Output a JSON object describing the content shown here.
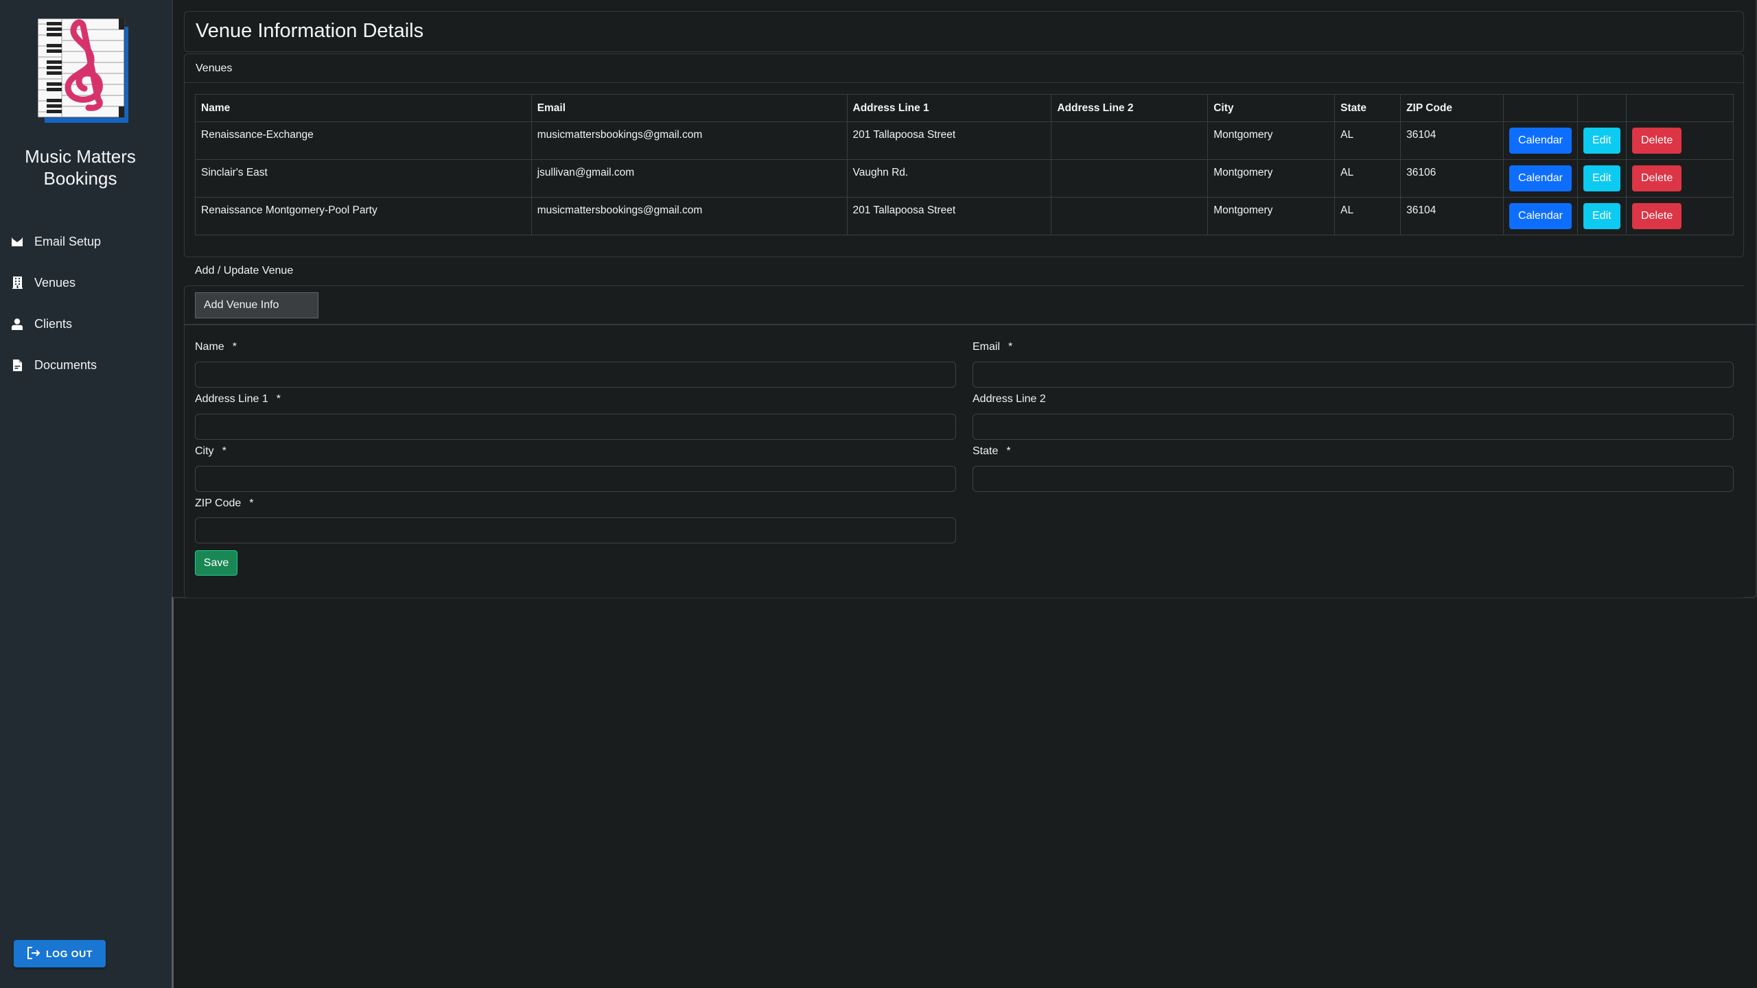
{
  "sidebar": {
    "brand": "Music Matters Bookings",
    "brand_line1": "Music Matters",
    "brand_line2": "Bookings",
    "logo": "treble-clef-piano-logo",
    "items": [
      {
        "label": "Email Setup",
        "icon": "envelope-icon"
      },
      {
        "label": "Venues",
        "icon": "building-icon"
      },
      {
        "label": "Clients",
        "icon": "person-icon"
      },
      {
        "label": "Documents",
        "icon": "document-icon"
      }
    ],
    "logout_label": "LOG OUT",
    "logout_icon": "logout-icon"
  },
  "page": {
    "title": "Venue Information Details"
  },
  "venues": {
    "header": "Venues",
    "columns": [
      "Name",
      "Email",
      "Address Line 1",
      "Address Line 2",
      "City",
      "State",
      "ZIP Code",
      "",
      "",
      ""
    ],
    "rows": [
      {
        "name": "Renaissance-Exchange",
        "email": "musicmattersbookings@gmail.com",
        "address1": "201 Tallapoosa Street",
        "address2": "",
        "city": "Montgomery",
        "state": "AL",
        "zip": "36104"
      },
      {
        "name": "Sinclair's East",
        "email": "jsullivan@gmail.com",
        "address1": "Vaughn Rd.",
        "address2": "",
        "city": "Montgomery",
        "state": "AL",
        "zip": "36106"
      },
      {
        "name": "Renaissance Montgomery-Pool Party",
        "email": "musicmattersbookings@gmail.com",
        "address1": "201 Tallapoosa Street",
        "address2": "",
        "city": "Montgomery",
        "state": "AL",
        "zip": "36104"
      }
    ],
    "actions": {
      "calendar": "Calendar",
      "edit": "Edit",
      "delete": "Delete"
    },
    "colors": {
      "calendar": "#0d6efd",
      "edit": "#0dcaf0",
      "delete": "#dc3545"
    }
  },
  "form": {
    "section_label": "Add / Update Venue",
    "tab_label": "Add Venue Info",
    "required_marker": "*",
    "fields": {
      "name": {
        "label": "Name",
        "value": "",
        "placeholder": ""
      },
      "email": {
        "label": "Email",
        "value": "",
        "placeholder": ""
      },
      "address1": {
        "label": "Address Line 1",
        "value": "",
        "placeholder": ""
      },
      "address2": {
        "label": "Address Line 2",
        "value": "",
        "placeholder": ""
      },
      "city": {
        "label": "City",
        "value": "",
        "placeholder": ""
      },
      "state": {
        "label": "State",
        "value": "",
        "placeholder": ""
      },
      "zip": {
        "label": "ZIP Code",
        "value": "",
        "placeholder": ""
      }
    },
    "save_label": "Save",
    "save_color": "#198754"
  }
}
